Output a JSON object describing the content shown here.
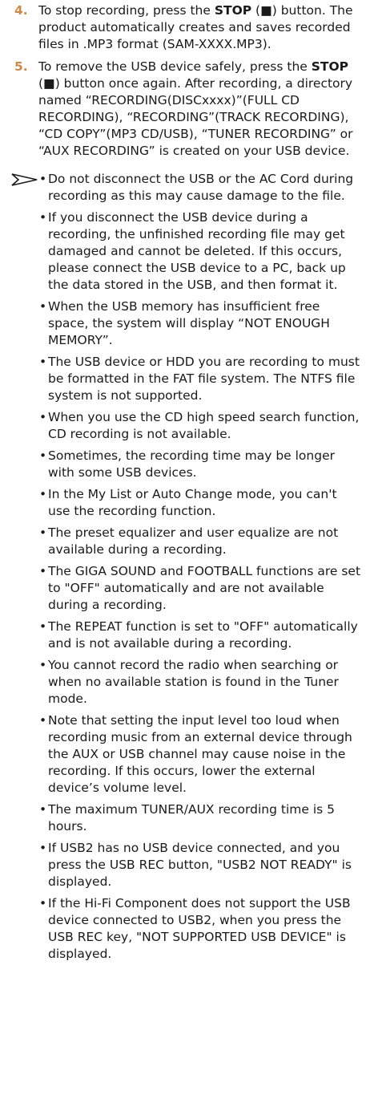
{
  "steps": [
    {
      "number": "4.",
      "parts": [
        "To stop recording, press the ",
        "STOP",
        " (■) button. The product automatically creates and saves recorded files in .MP3 format (SAM-XXXX.MP3)."
      ]
    },
    {
      "number": "5.",
      "parts": [
        "To remove the USB device safely, press the ",
        "STOP",
        " (■) button once again. After recording, a directory named “RECORDING(DISCxxxx)”(FULL CD RECORDING), “RECORDING”(TRACK RECORDING), “CD COPY”(MP3 CD/USB), “TUNER RECORDING” or “AUX RECORDING” is created on your USB device."
      ]
    }
  ],
  "notes_icon": "arrow-pointer-icon",
  "bullet_char": "•",
  "notes": [
    "Do not disconnect the USB or the AC Cord during recording as this may cause damage to the file.",
    "If you disconnect the USB device during a recording, the unfinished recording file may get damaged and cannot be deleted. If this occurs, please connect the USB device to a PC, back up the data stored in the USB, and then format it.",
    "When the USB memory has insufficient free space, the system will display “NOT ENOUGH MEMORY”.",
    "The USB device or HDD you are recording to must be  formatted in the FAT file system. The NTFS file system is not supported.",
    "When you use the CD high speed search function, CD recording is not available.",
    "Sometimes, the recording time may be longer with some USB devices.",
    "In the My List or Auto Change mode, you can't use the recording function.",
    "The preset equalizer and user equalize are not available during a recording.",
    "The GIGA SOUND and FOOTBALL functions are set to \"OFF\" automatically and are not available during a recording.",
    "The REPEAT function is set to \"OFF\" automatically and is not available during a recording.",
    "You cannot record the radio when searching or when no available station is found in the Tuner mode.",
    "Note that setting the input level too loud when recording music from an external device through the AUX or USB channel may cause noise in the recording. If this occurs, lower the external device’s volume level.",
    "The maximum TUNER/AUX recording time is 5 hours.",
    "If USB2 has no USB device connected, and you press the USB REC button, \"USB2 NOT READY\" is displayed.",
    "If the Hi-Fi Component does not support the USB device connected to USB2, when you press the USB REC key, \"NOT SUPPORTED USB DEVICE\" is displayed."
  ]
}
